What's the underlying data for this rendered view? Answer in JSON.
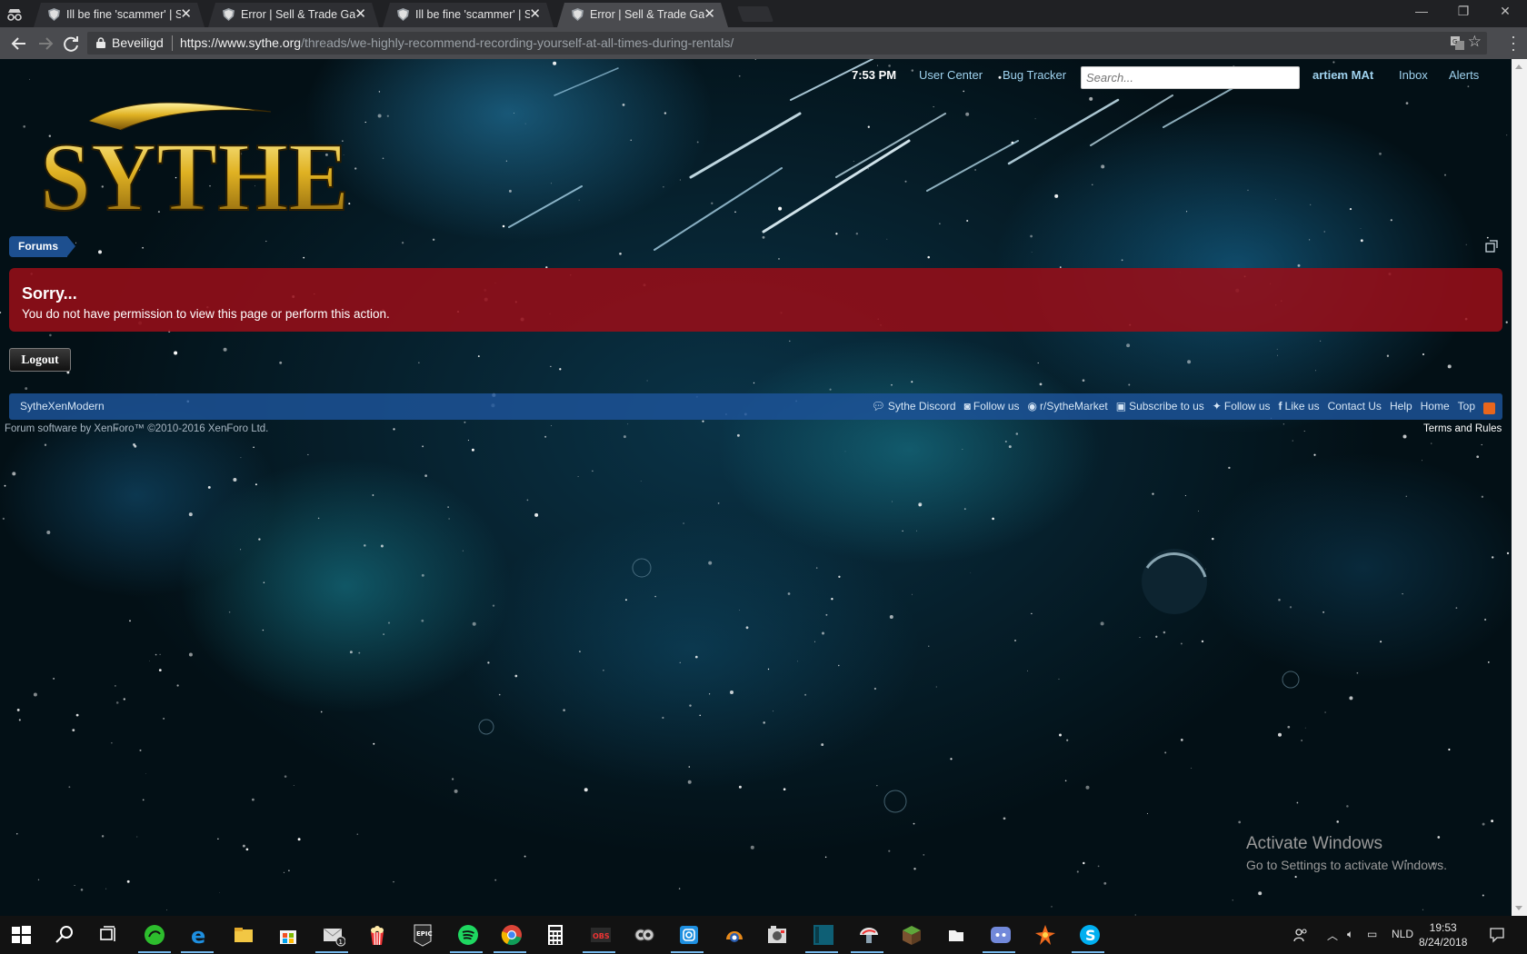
{
  "browser": {
    "tabs": [
      {
        "title": "Ill be fine 'scammer' | Sell",
        "active": false
      },
      {
        "title": "Error | Sell & Trade Game",
        "active": false
      },
      {
        "title": "Ill be fine 'scammer' | Sell",
        "active": false
      },
      {
        "title": "Error | Sell & Trade Game",
        "active": true
      }
    ],
    "security_label": "Beveiligd",
    "url_scheme": "https://",
    "url_host": "www.sythe.org",
    "url_path": "/threads/we-highly-recommend-recording-yourself-at-all-times-during-rentals/",
    "close_glyph": "✕",
    "minimize_glyph": "—",
    "maximize_glyph": "❐",
    "window_close_glyph": "✕"
  },
  "header": {
    "time": "7:53 PM",
    "user_center": "User Center",
    "bug_tracker": "Bug Tracker",
    "search_placeholder": "Search...",
    "username": "artiem MAt",
    "inbox": "Inbox",
    "alerts": "Alerts"
  },
  "logo_text": "SYTHE",
  "breadcrumb": "Forums",
  "error": {
    "title": "Sorry...",
    "message": "You do not have permission to view this page or perform this action."
  },
  "logout_label": "Logout",
  "footer": {
    "style_name": "SytheXenModern",
    "links": [
      {
        "icon": "chat-icon",
        "label": "Sythe Discord"
      },
      {
        "icon": "instagram-icon",
        "label": "Follow us"
      },
      {
        "icon": "reddit-icon",
        "label": "r/SytheMarket"
      },
      {
        "icon": "youtube-icon",
        "label": "Subscribe to us"
      },
      {
        "icon": "twitter-icon",
        "label": "Follow us"
      },
      {
        "icon": "facebook-icon",
        "label": "Like us"
      },
      {
        "icon": "",
        "label": "Contact Us"
      },
      {
        "icon": "",
        "label": "Help"
      },
      {
        "icon": "",
        "label": "Home"
      },
      {
        "icon": "",
        "label": "Top"
      }
    ],
    "copyright": "Forum software by XenForo™ ©2010-2016 XenForo Ltd.",
    "terms": "Terms and Rules"
  },
  "watermark": {
    "line1": "Activate Windows",
    "line2": "Go to Settings to activate Windows."
  },
  "taskbar": {
    "language": "NLD",
    "clock_time": "19:53",
    "clock_date": "8/24/2018",
    "mail_badge": "1",
    "apps": [
      "windows-start-icon",
      "search-icon",
      "task-view-icon",
      "razer-icon",
      "edge-icon",
      "file-explorer-icon",
      "store-icon",
      "mail-icon",
      "popcorn-icon",
      "epic-games-icon",
      "spotify-icon",
      "chrome-icon",
      "calculator-icon",
      "obs-icon",
      "tor-icon",
      "instagram-icon",
      "blender-icon",
      "photo-icon",
      "bookmark-app-icon",
      "mushroom-icon",
      "minecraft-icon",
      "folder-icon",
      "discord-icon",
      "game-icon",
      "skype-icon"
    ]
  },
  "colors": {
    "error_red": "#960e18",
    "footer_blue": "#1c5296",
    "crumb_blue": "#1d4f8f",
    "link_blue": "#9fd2ee"
  }
}
